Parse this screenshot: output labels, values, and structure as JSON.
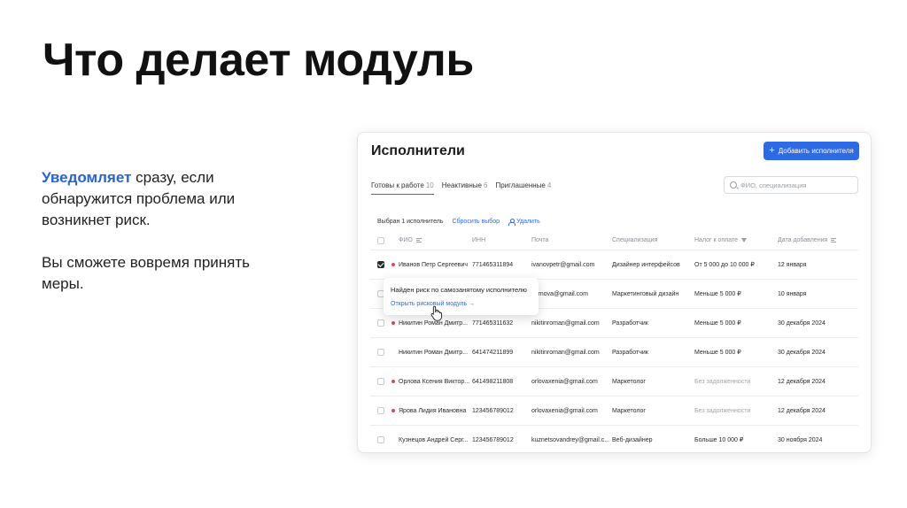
{
  "slide": {
    "title": "Что делает модуль",
    "description": {
      "accent": "Уведомляет",
      "line1_rest": " сразу, если обнаружится проблема или возникнет риск.",
      "line2": "Вы сможете вовремя принять меры."
    }
  },
  "app": {
    "title": "Исполнители",
    "add_button": "Добавить исполнителя",
    "tabs": [
      {
        "label": "Готовы к работе",
        "count": "10",
        "active": true
      },
      {
        "label": "Неактивные",
        "count": "6"
      },
      {
        "label": "Приглашенные",
        "count": "4"
      }
    ],
    "search_placeholder": "ФИО, специализация",
    "selection": {
      "selected_text": "Выбран 1 исполнитель",
      "reset_label": "Сбросить выбор",
      "delete_label": "Удалить"
    },
    "columns": [
      "ФИО",
      "ИНН",
      "Почта",
      "Специализация",
      "Налог к оплате",
      "Дата добавления"
    ],
    "rows": [
      {
        "name": "Иванов Петр Сергеевич",
        "inn": "771465311894",
        "email": "ivanovpetr@gmail.com",
        "spec": "Дизайнер интерфейсов",
        "tax": "От 5 000 до 10 000 ₽",
        "date": "12 января"
      },
      {
        "name": "",
        "inn": "",
        "email": "mirnova@gmail.com",
        "spec": "Маркетинговый дизайн",
        "tax": "Меньше 5 000 ₽",
        "date": "10 января"
      },
      {
        "name": "Никитин Роман Дмитр...",
        "inn": "771465311632",
        "email": "nikitinroman@gmail.com",
        "spec": "Разработчик",
        "tax": "Меньше 5 000 ₽",
        "date": "30 декабря 2024"
      },
      {
        "name": "Никитин Роман Дмитр...",
        "inn": "641474211899",
        "email": "nikitinroman@gmail.com",
        "spec": "Разработчик",
        "tax": "Меньше 5 000 ₽",
        "date": "30 декабря 2024"
      },
      {
        "name": "Орлова Ксения Виктор...",
        "inn": "641498211808",
        "email": "orlovaxenia@gmail.com",
        "spec": "Маркетолог",
        "tax": "Без задолженности",
        "date": "12 декабря 2024"
      },
      {
        "name": "Ярова Лидия Ивановна",
        "inn": "123456789012",
        "email": "orlovaxenia@gmail.com",
        "spec": "Маркетолог",
        "tax": "Без задолженности",
        "date": "12 декабря 2024"
      },
      {
        "name": "Кузнецов Андрей Серг...",
        "inn": "123456789012",
        "email": "kuznetsovandrey@gmail.c...",
        "spec": "Веб-дизайнер",
        "tax": "Больше 10 000 ₽",
        "date": "30 ноября 2024"
      }
    ],
    "popover": {
      "title": "Найден риск по самозанятому исполнителю",
      "link": "Открыть рисковый модуль →"
    }
  },
  "colors": {
    "accent": "#2f6ae6",
    "risk": "#e5484d",
    "text_accent": "#2563d9"
  }
}
